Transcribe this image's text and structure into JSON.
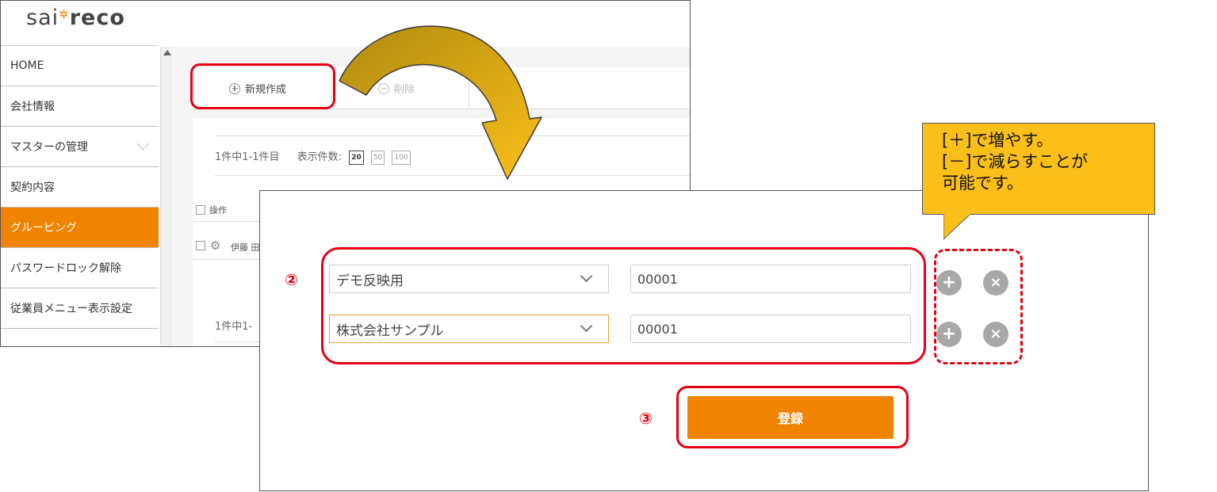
{
  "app": {
    "logo_light": "sai",
    "logo_star": "✲",
    "logo_bold": "reco"
  },
  "sidebar": {
    "items": [
      {
        "label": "HOME"
      },
      {
        "label": "会社情報"
      },
      {
        "label": "マスターの管理"
      },
      {
        "label": "契約内容"
      },
      {
        "label": "グルーピング"
      },
      {
        "label": "パスワードロック解除"
      },
      {
        "label": "従業員メニュー表示設定"
      }
    ],
    "active_index": 4
  },
  "toolbar": {
    "new_label": "新規作成",
    "delete_label": "削除"
  },
  "list": {
    "paging_text": "1件中1-1件目",
    "page_size_label": "表示件数:",
    "page_sizes": [
      "20",
      "50",
      "100"
    ],
    "selected_page_size": "20",
    "column_operation": "操作",
    "row_name_partial": "伊藤 田",
    "paging_text_bottom": "1件中1-"
  },
  "callout": {
    "line1": "[＋]で増やす。",
    "line2": "[－]で減らすことが",
    "line3": "可能です。",
    "color": "#fbbf19"
  },
  "markers": {
    "step2": "②",
    "step3": "③"
  },
  "form": {
    "rows": [
      {
        "select_value": "デモ反映用",
        "code_value": "00001",
        "focused": false
      },
      {
        "select_value": "株式会社サンプル",
        "code_value": "00001",
        "focused": true
      }
    ],
    "register_label": "登録"
  },
  "colors": {
    "accent": "#f08300",
    "highlight_red": "#e60012"
  }
}
